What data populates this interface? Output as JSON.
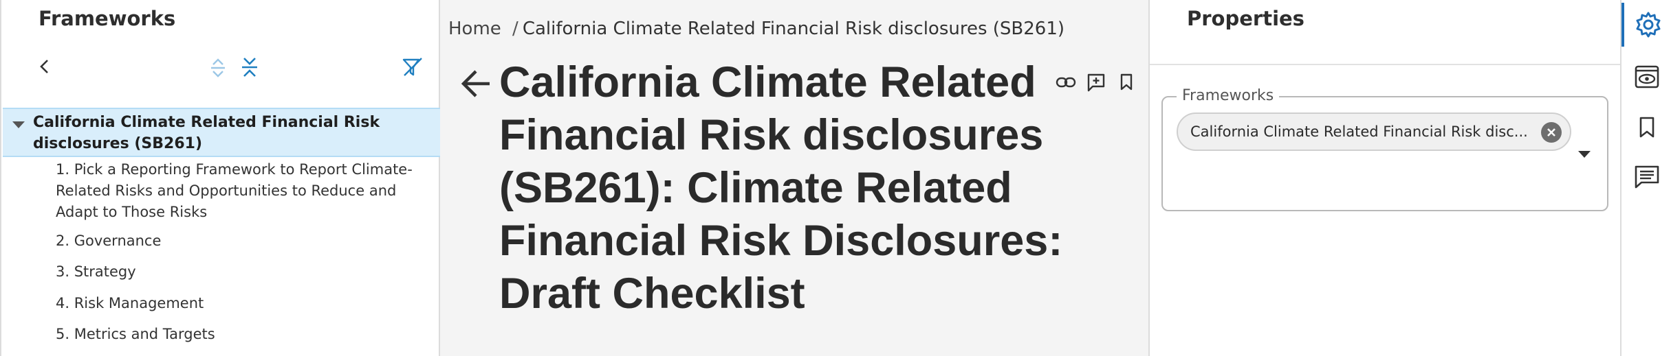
{
  "left_panel": {
    "title": "Frameworks",
    "toolbar": {
      "back_icon": "chevron-left-icon",
      "expand_icon": "expand-all-icon",
      "collapse_icon": "collapse-all-icon",
      "filter_icon": "filter-clear-icon"
    },
    "tree": {
      "root": {
        "label": "California Climate Related Financial Risk disclosures (SB261)",
        "expanded": true,
        "selected": true
      },
      "children": [
        {
          "label": "1. Pick a Reporting Framework to Report Climate-Related Risks and Opportunities to Reduce and Adapt to Those Risks"
        },
        {
          "label": "2. Governance"
        },
        {
          "label": "3. Strategy"
        },
        {
          "label": "4. Risk Management"
        },
        {
          "label": "5. Metrics and Targets"
        }
      ]
    }
  },
  "center": {
    "breadcrumb": {
      "home": "Home",
      "separator": "/",
      "current": "California Climate Related Financial Risk disclosures (SB261)"
    },
    "title": "California Climate Related Financial Risk disclosures (SB261): Climate Related Financial Risk Disclosures: Draft Checklist",
    "actions": [
      "link-icon",
      "add-comment-icon",
      "bookmark-icon"
    ]
  },
  "properties": {
    "title": "Properties",
    "frameworks_field": {
      "label": "Frameworks",
      "chip": "California Climate Related Financial Risk disc..."
    }
  },
  "rail": {
    "items": [
      "settings-icon",
      "preview-icon",
      "bookmark-icon",
      "comments-icon"
    ],
    "active": "settings-icon"
  },
  "colors": {
    "accent": "#1f6fb8",
    "selected_row_bg": "#d9eefb",
    "content_bg": "#f4f4f4",
    "icon_teal": "#1f7fc0"
  }
}
